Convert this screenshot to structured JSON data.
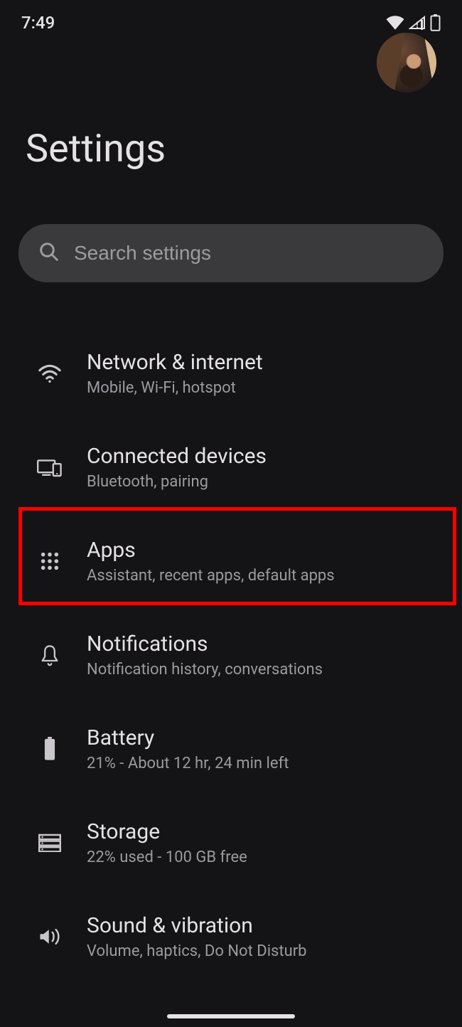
{
  "status": {
    "time": "7:49"
  },
  "page_title": "Settings",
  "search": {
    "placeholder": "Search settings"
  },
  "items": [
    {
      "title": "Network & internet",
      "subtitle": "Mobile, Wi-Fi, hotspot",
      "icon": "wifi-icon"
    },
    {
      "title": "Connected devices",
      "subtitle": "Bluetooth, pairing",
      "icon": "devices-icon"
    },
    {
      "title": "Apps",
      "subtitle": "Assistant, recent apps, default apps",
      "icon": "apps-icon",
      "highlighted": true
    },
    {
      "title": "Notifications",
      "subtitle": "Notification history, conversations",
      "icon": "bell-icon"
    },
    {
      "title": "Battery",
      "subtitle": "21% - About 12 hr, 24 min left",
      "icon": "battery-icon"
    },
    {
      "title": "Storage",
      "subtitle": "22% used - 100 GB free",
      "icon": "storage-icon"
    },
    {
      "title": "Sound & vibration",
      "subtitle": "Volume, haptics, Do Not Disturb",
      "icon": "sound-icon"
    }
  ]
}
